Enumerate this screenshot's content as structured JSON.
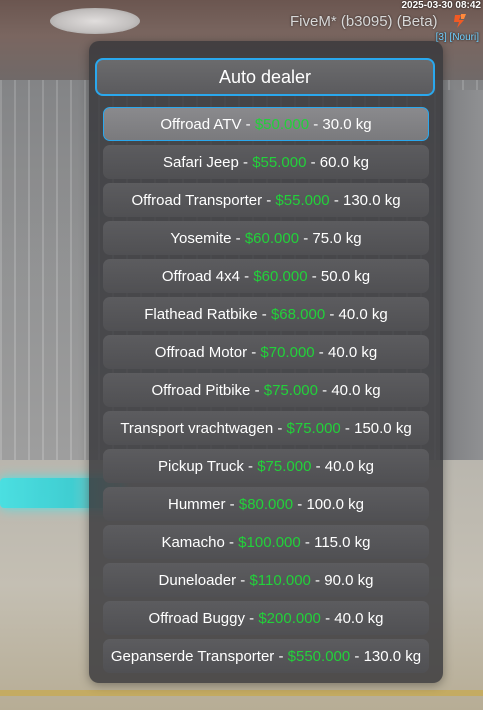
{
  "hud": {
    "timestamp": "2025-03-30 08:42",
    "app_title": "FiveM* (b3095) (Beta)",
    "player_tag": "[3] [Nouri]",
    "logo_icon": "fivem-logo-icon"
  },
  "menu": {
    "title": "Auto dealer",
    "accent_color": "#2aa8ee",
    "price_color": "#22d13a",
    "selected_index": 0,
    "items": [
      {
        "name": "Offroad ATV",
        "price": "$50.000",
        "weight": "30.0 kg"
      },
      {
        "name": "Safari Jeep",
        "price": "$55.000",
        "weight": "60.0 kg"
      },
      {
        "name": "Offroad Transporter",
        "price": "$55.000",
        "weight": "130.0 kg"
      },
      {
        "name": "Yosemite",
        "price": "$60.000",
        "weight": "75.0 kg"
      },
      {
        "name": "Offroad 4x4",
        "price": "$60.000",
        "weight": "50.0 kg"
      },
      {
        "name": "Flathead Ratbike",
        "price": "$68.000",
        "weight": "40.0 kg"
      },
      {
        "name": "Offroad Motor",
        "price": "$70.000",
        "weight": "40.0 kg"
      },
      {
        "name": "Offroad Pitbike",
        "price": "$75.000",
        "weight": "40.0 kg"
      },
      {
        "name": "Transport vrachtwagen",
        "price": "$75.000",
        "weight": "150.0 kg"
      },
      {
        "name": "Pickup Truck",
        "price": "$75.000",
        "weight": "40.0 kg"
      },
      {
        "name": "Hummer",
        "price": "$80.000",
        "weight": "100.0 kg"
      },
      {
        "name": "Kamacho",
        "price": "$100.000",
        "weight": "115.0 kg"
      },
      {
        "name": "Duneloader",
        "price": "$110.000",
        "weight": "90.0 kg"
      },
      {
        "name": "Offroad Buggy",
        "price": "$200.000",
        "weight": "40.0 kg"
      },
      {
        "name": "Gepanserde Transporter",
        "price": "$550.000",
        "weight": "130.0 kg"
      }
    ]
  }
}
